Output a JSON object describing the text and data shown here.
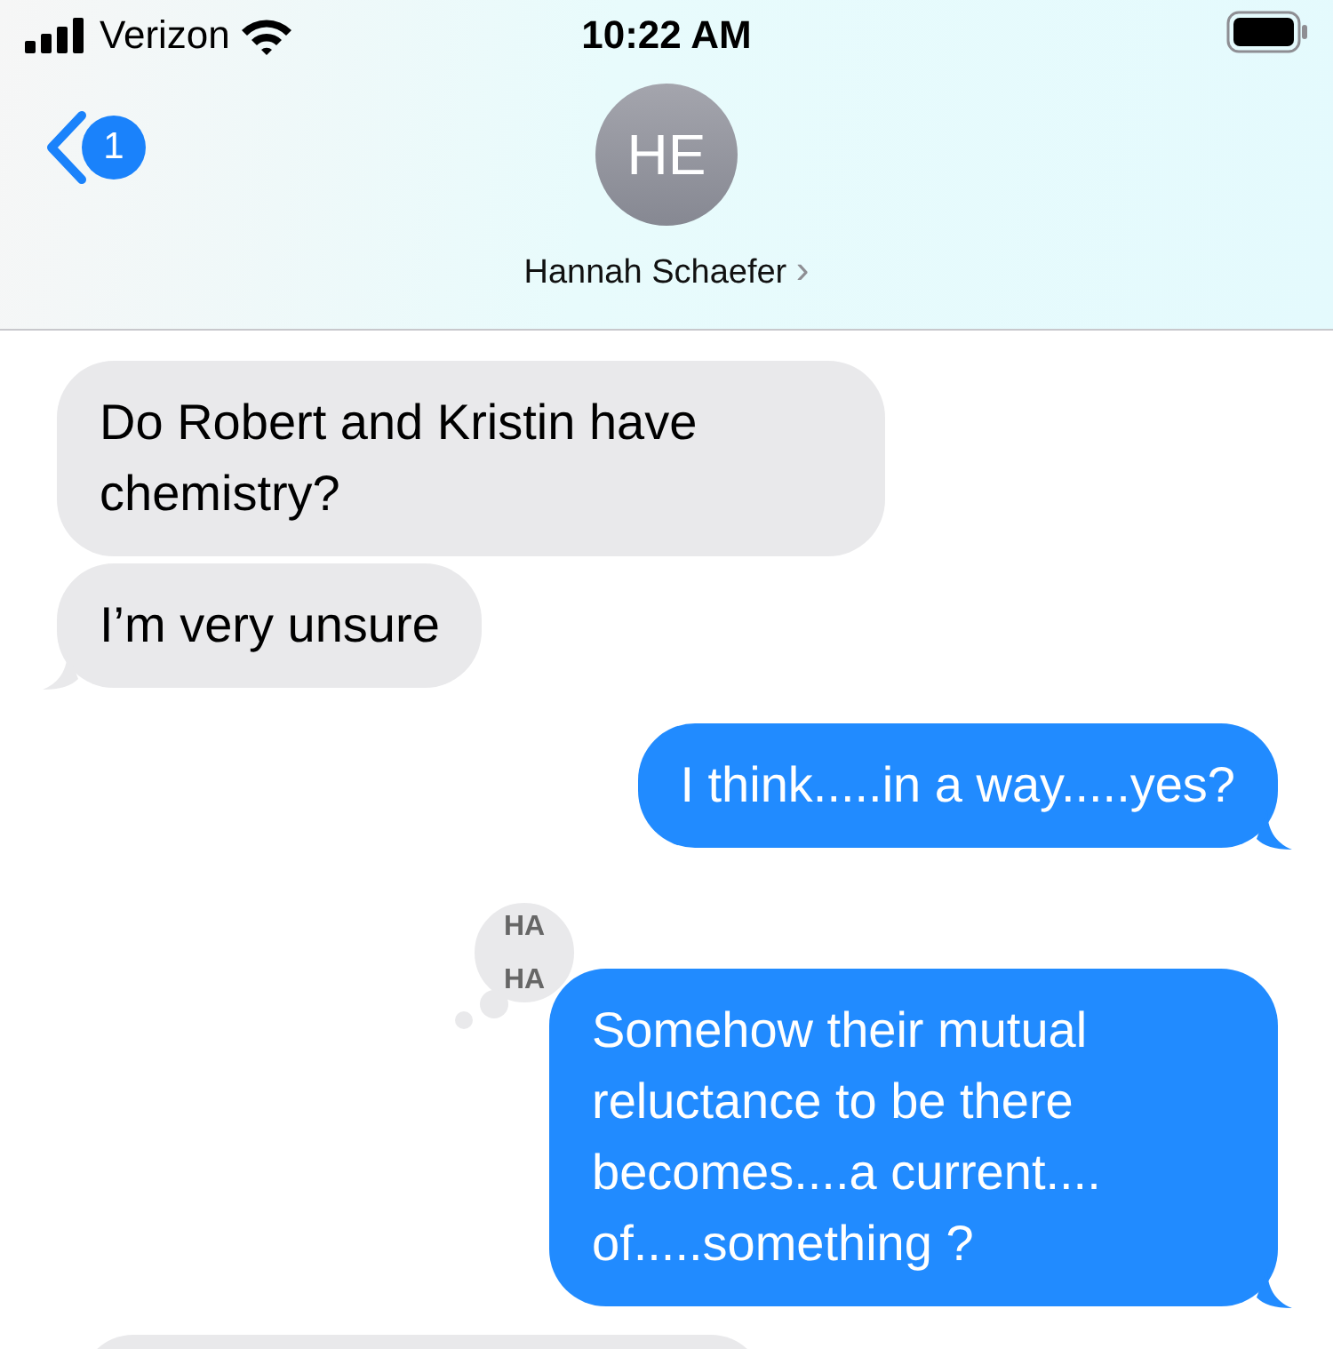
{
  "status_bar": {
    "carrier": "Verizon",
    "time": "10:22 AM"
  },
  "header": {
    "back_badge": "1",
    "avatar_initials": "HE",
    "contact_name": "Hannah Schaefer",
    "chevron": "›"
  },
  "messages": [
    {
      "kind": "incoming",
      "text": "Do Robert and Kristin have chemistry?",
      "tail": false
    },
    {
      "kind": "incoming",
      "text": "I’m very unsure",
      "tail": true
    },
    {
      "kind": "outgoing",
      "text": "I think.....in a way.....yes?",
      "tail": true
    },
    {
      "kind": "outgoing",
      "text": "Somehow their mutual reluctance to be there becomes....a current.... of.....something ?",
      "tail": true,
      "reaction": [
        "HA",
        "HA"
      ]
    },
    {
      "kind": "incoming-partial"
    }
  ]
}
